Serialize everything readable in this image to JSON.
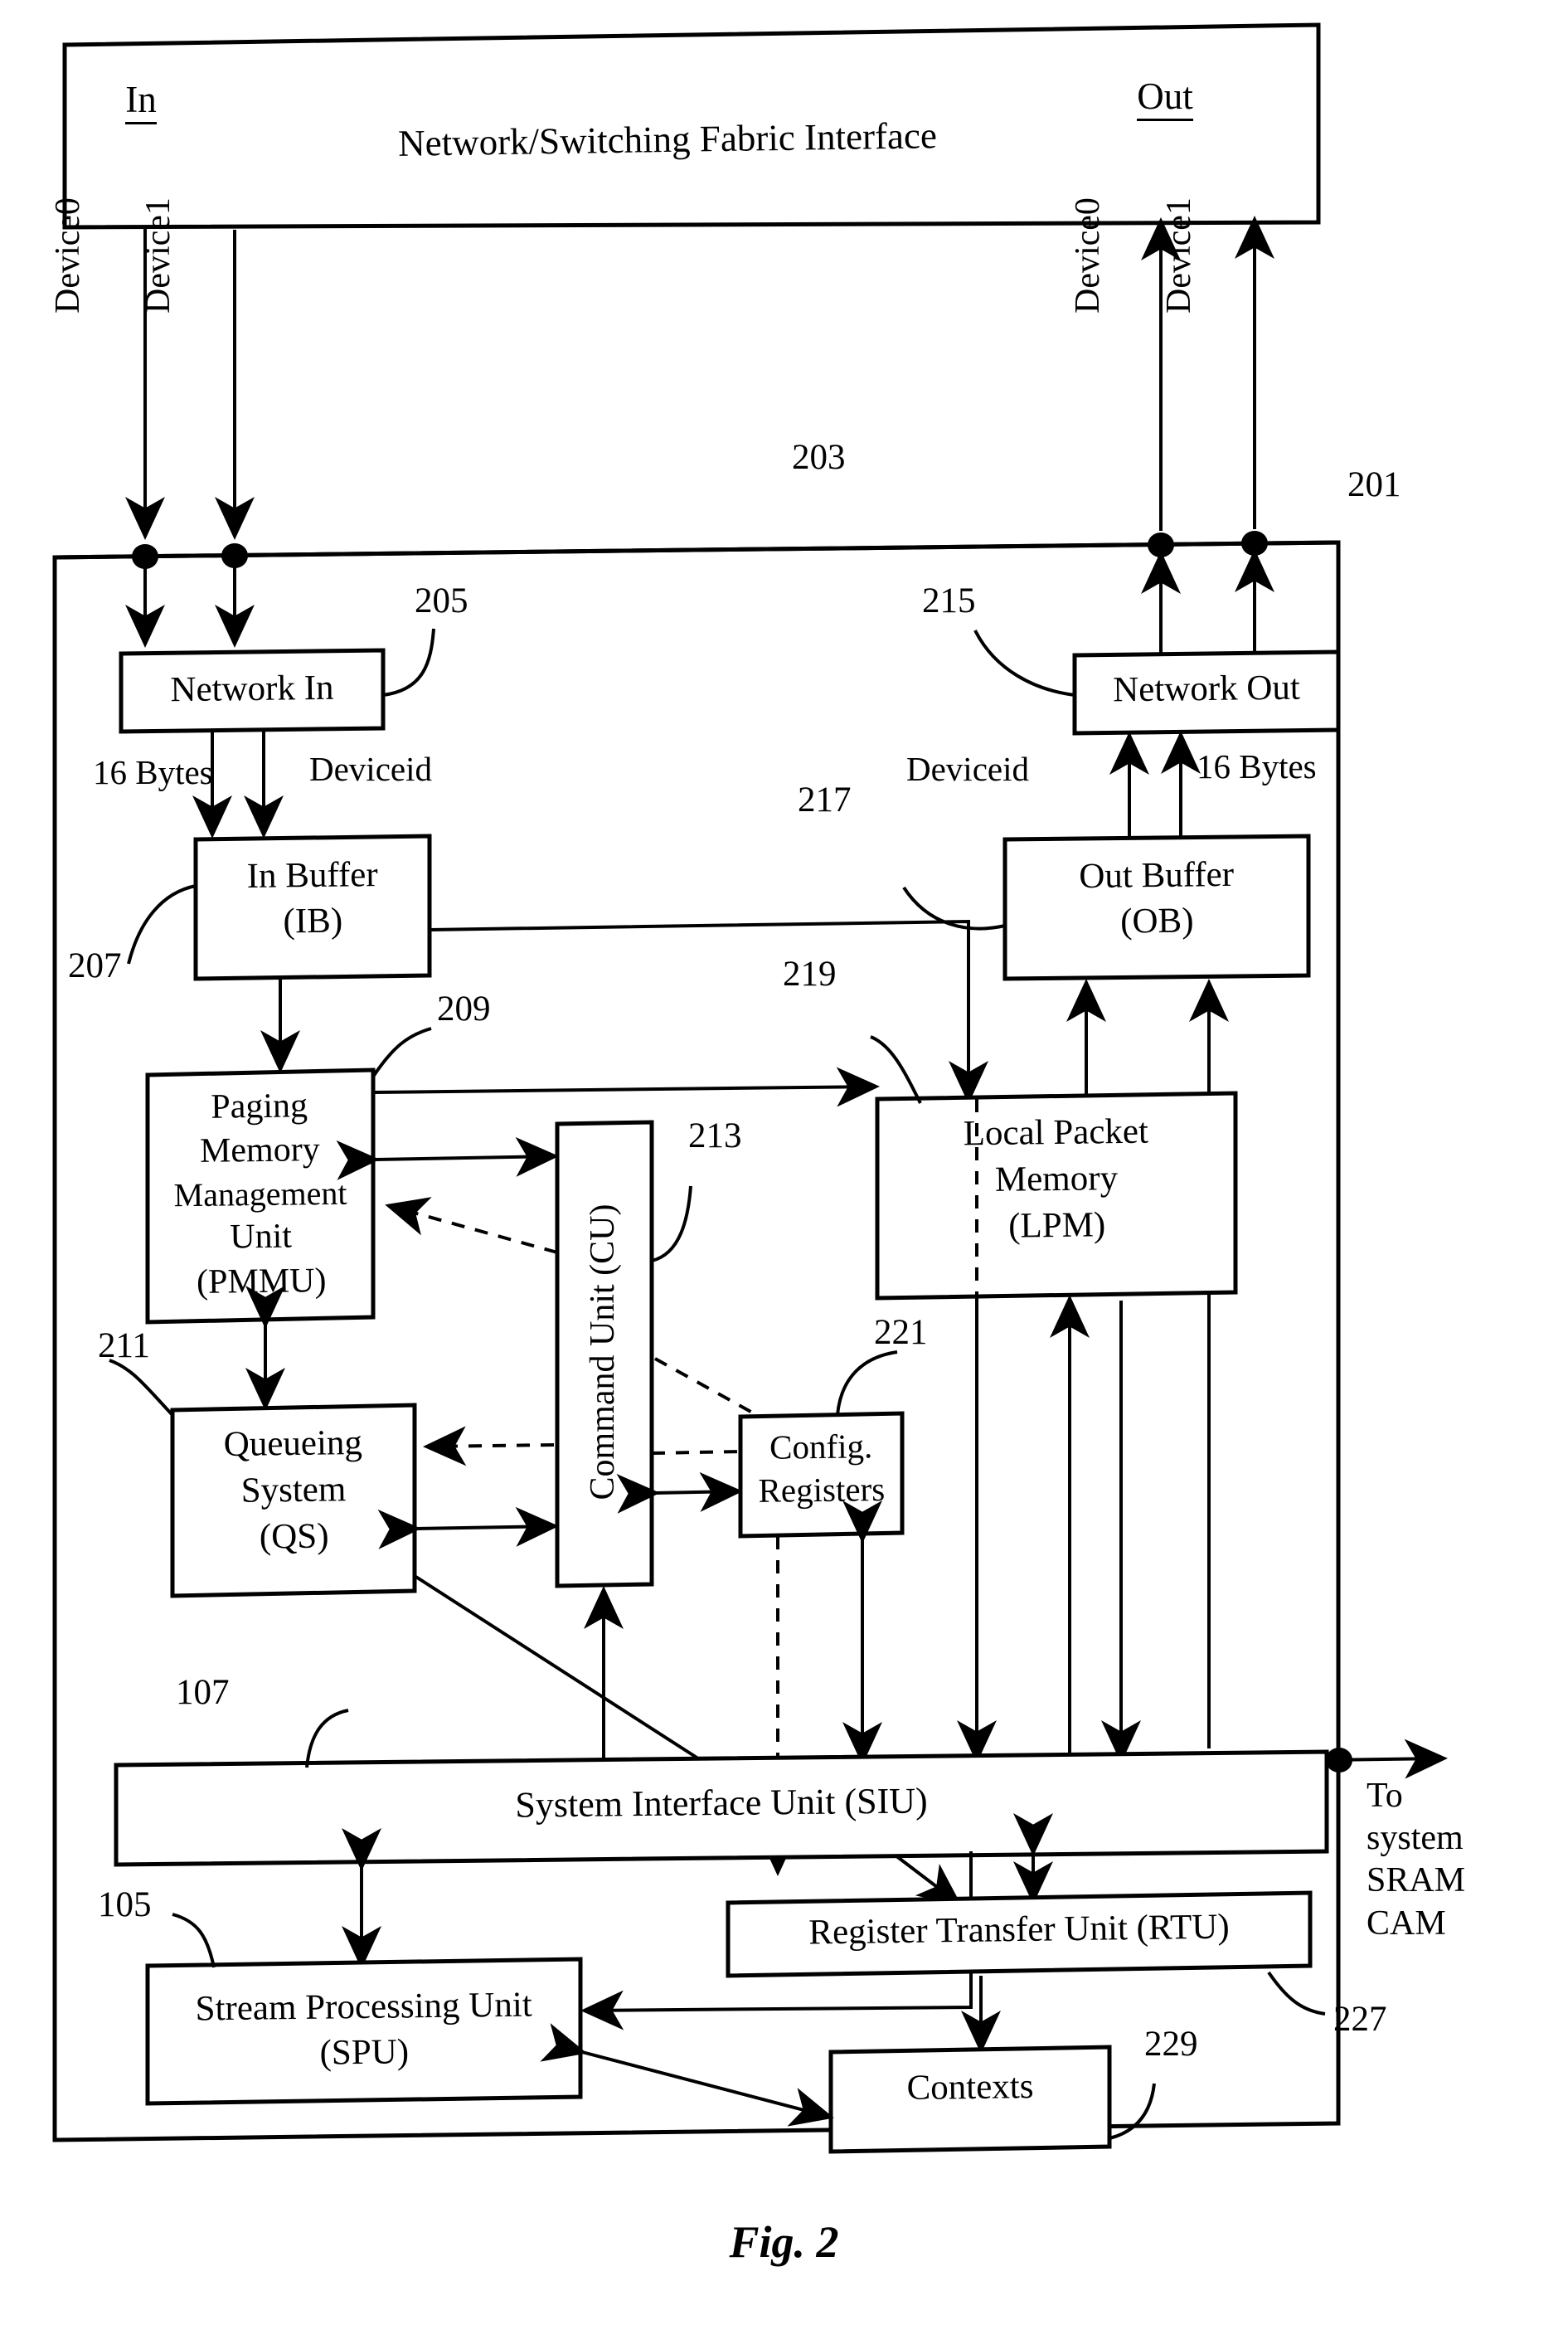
{
  "figure": {
    "caption": "Fig. 2"
  },
  "outer_blocks": [
    {
      "id": "fabric",
      "label": "Network/Switching Fabric Interface",
      "ref": "203"
    },
    {
      "id": "device",
      "label": "",
      "ref": "201"
    }
  ],
  "fabric": {
    "title": "Network/Switching Fabric Interface",
    "in_heading": "In",
    "out_heading": "Out",
    "in_ports": [
      "Device0",
      "Device1"
    ],
    "out_ports": [
      "Device0",
      "Device1"
    ],
    "ref": "203"
  },
  "chip": {
    "ref": "201"
  },
  "blocks": {
    "network_in": {
      "label": "Network In",
      "ref": "205"
    },
    "in_buffer": {
      "line1": "In Buffer",
      "line2": "(IB)",
      "ref": "207"
    },
    "pmmu": {
      "line1": "Paging",
      "line2": "Memory",
      "line3": "Management",
      "line4": "Unit",
      "line5": "(PMMU)",
      "ref": "209"
    },
    "queueing": {
      "line1": "Queueing",
      "line2": "System",
      "line3": "(QS)",
      "ref": "211"
    },
    "command_unit": {
      "label": "Command Unit (CU)",
      "ref": "213"
    },
    "network_out": {
      "label": "Network Out",
      "ref": "215"
    },
    "out_buffer": {
      "line1": "Out Buffer",
      "line2": "(OB)",
      "ref": "217"
    },
    "lpm": {
      "line1": "Local Packet",
      "line2": "Memory",
      "line3": "(LPM)",
      "ref": "219"
    },
    "config_registers": {
      "line1": "Config.",
      "line2": "Registers",
      "ref": "221"
    },
    "siu": {
      "label": "System Interface Unit (SIU)",
      "ref": "107"
    },
    "spu": {
      "line1": "Stream Processing Unit",
      "line2": "(SPU)",
      "ref": "105"
    },
    "rtu": {
      "label": "Register Transfer Unit (RTU)",
      "ref": "227"
    },
    "contexts": {
      "label": "Contexts",
      "ref": "229"
    }
  },
  "edge_labels": {
    "in_16bytes": "16 Bytes",
    "in_deviceid": "Deviceid",
    "out_deviceid": "Deviceid",
    "out_16bytes": "16 Bytes"
  },
  "external": {
    "to_system_line1": "To",
    "to_system_line2": "system",
    "to_system_line3": "SRAM",
    "to_system_line4": "CAM"
  },
  "colors": {
    "ink": "#000000",
    "paper": "#ffffff"
  }
}
